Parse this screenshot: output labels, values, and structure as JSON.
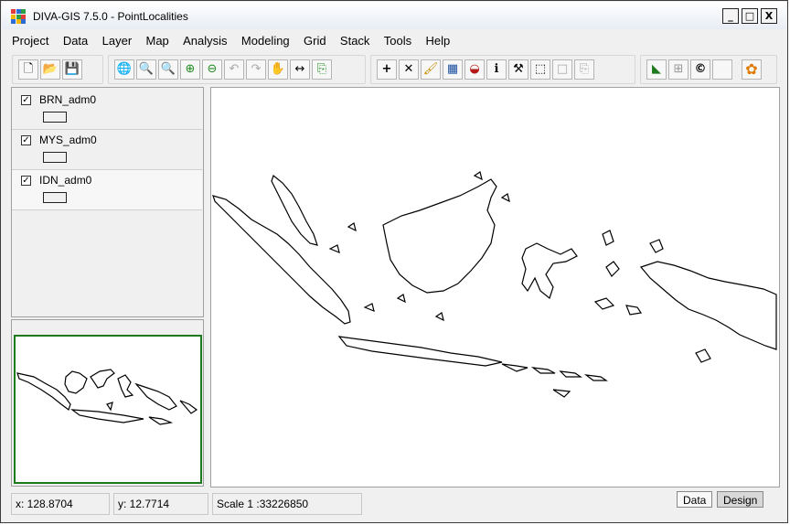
{
  "window": {
    "title": "DIVA-GIS 7.5.0 - PointLocalities"
  },
  "titlebar_buttons": {
    "minimize": "_",
    "maximize": "□",
    "close": "X"
  },
  "menu": [
    "Project",
    "Data",
    "Layer",
    "Map",
    "Analysis",
    "Modeling",
    "Grid",
    "Stack",
    "Tools",
    "Help"
  ],
  "toolbar": {
    "new": "new-doc-icon",
    "open": "folder-open-icon",
    "save": "save-icon",
    "full_extent": "globe-icon",
    "zoom_layer": "zoom-layer-icon",
    "zoom_selection": "zoom-selection-icon",
    "zoom_in": "zoom-in-icon",
    "zoom_out": "zoom-out-icon",
    "undo_extent": "undo-icon",
    "redo_extent": "redo-icon",
    "pan": "hand-icon",
    "measure": "measure-icon",
    "copy_map": "copy-map-icon",
    "add_point": "plus-icon",
    "delete": "delete-icon",
    "edit": "brush-icon",
    "table": "table-icon",
    "query": "query-icon",
    "info": "info-icon",
    "tools": "hammer-icon",
    "select": "select-icon",
    "blank": "blank-icon",
    "copy_feature": "copy-feature-icon",
    "feature": "feature-icon",
    "grid": "grid-icon",
    "copyright": "c-icon",
    "blank2": "blank-icon",
    "flower": "flower-icon"
  },
  "toolbar_glyphs": {
    "new": "🗋",
    "open": "📂",
    "save": "💾",
    "full_extent": "🌐",
    "zoom_layer": "🔍",
    "zoom_selection": "🔍",
    "zoom_in": "⊕",
    "zoom_out": "⊖",
    "undo_extent": "↶",
    "redo_extent": "↷",
    "pan": "✋",
    "measure": "↔",
    "copy_map": "⎘",
    "add_point": "+",
    "delete": "✕",
    "edit": "🖌",
    "table": "▦",
    "query": "◒",
    "info": "ℹ",
    "tools": "⚒",
    "select": "⬚",
    "blank": "□",
    "copy_feature": "⎘",
    "feature": "◣",
    "grid": "⊞",
    "copyright": "©",
    "blank2": "",
    "flower": "✿"
  },
  "layers": [
    {
      "name": "BRN_adm0",
      "checked": true
    },
    {
      "name": "MYS_adm0",
      "checked": true
    },
    {
      "name": "IDN_adm0",
      "checked": true
    }
  ],
  "status": {
    "x": "x: 128.8704",
    "y": "y: 12.7714",
    "scale": "Scale 1 :33226850"
  },
  "tabs": {
    "data": "Data",
    "design": "Design"
  },
  "colors": {
    "overview_frame": "#1f7a1f",
    "map_bg": "#ffffff"
  }
}
